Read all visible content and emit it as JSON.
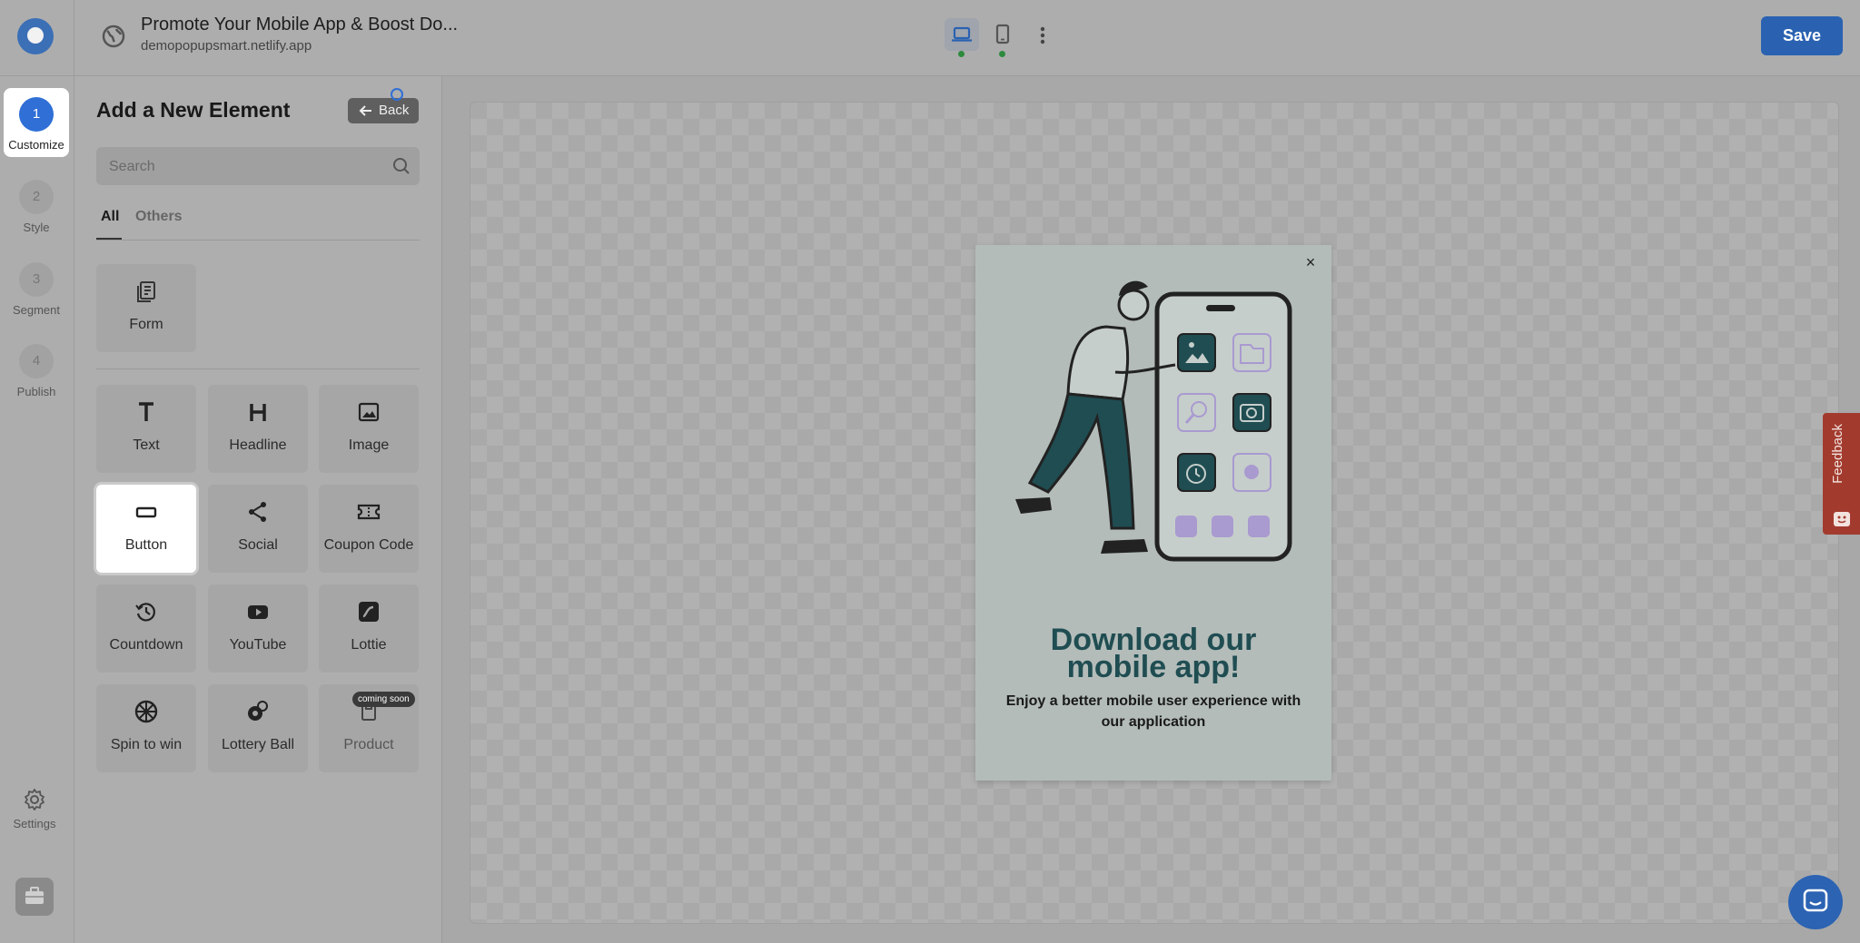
{
  "header": {
    "title": "Promote Your Mobile App & Boost Do...",
    "subtitle": "demopopupsmart.netlify.app",
    "save_label": "Save"
  },
  "steps": [
    {
      "num": "1",
      "label": "Customize",
      "active": true
    },
    {
      "num": "2",
      "label": "Style",
      "active": false
    },
    {
      "num": "3",
      "label": "Segment",
      "active": false
    },
    {
      "num": "4",
      "label": "Publish",
      "active": false
    }
  ],
  "settings_label": "Settings",
  "panel": {
    "title": "Add a New Element",
    "back_label": "Back",
    "search_placeholder": "Search",
    "tabs": [
      "All",
      "Others"
    ],
    "form_tile": "Form",
    "tiles": [
      "Text",
      "Headline",
      "Image",
      "Button",
      "Social",
      "Coupon Code",
      "Countdown",
      "YouTube",
      "Lottie",
      "Spin to win",
      "Lottery Ball",
      "Product"
    ],
    "selected_tile": "Button",
    "coming_soon": "coming soon"
  },
  "popup": {
    "close": "×",
    "headline_line1": "Download our",
    "headline_line2": "mobile app!",
    "sub_line1": "Enjoy a better mobile user experience with",
    "sub_line2": "our application"
  },
  "feedback_label": "Feedback",
  "colors": {
    "accent": "#2a62b1",
    "headline": "#1f4d52",
    "feedback": "#a23b2e"
  }
}
